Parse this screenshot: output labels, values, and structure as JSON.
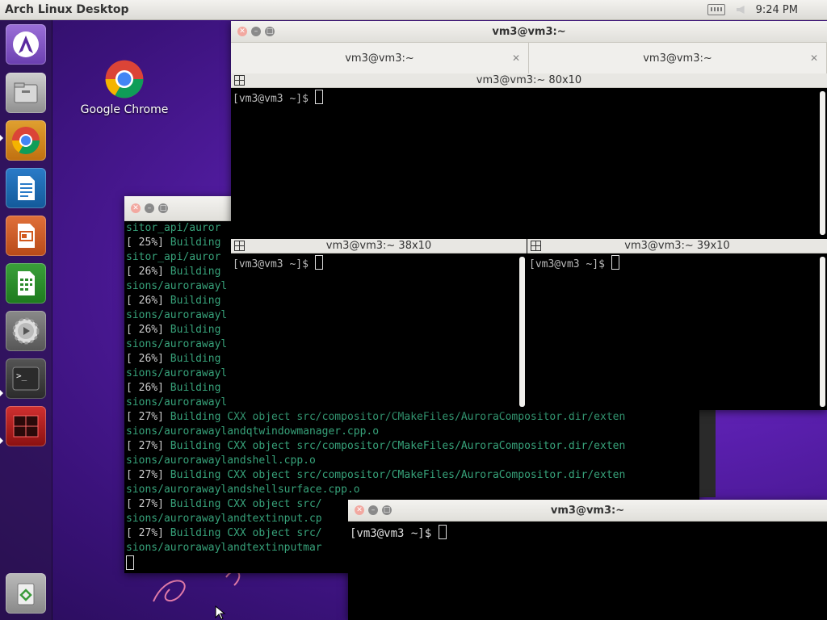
{
  "topbar": {
    "title": "Arch Linux Desktop",
    "time": "9:24 PM"
  },
  "launcher": {
    "items": [
      {
        "name": "arch-logo-icon"
      },
      {
        "name": "files-icon"
      },
      {
        "name": "chrome-icon"
      },
      {
        "name": "libreoffice-writer-icon"
      },
      {
        "name": "libreoffice-impress-icon"
      },
      {
        "name": "libreoffice-calc-icon"
      },
      {
        "name": "settings-icon"
      },
      {
        "name": "terminal-icon"
      },
      {
        "name": "terminator-icon"
      },
      {
        "name": "trash-icon"
      }
    ]
  },
  "desktop_icons": [
    {
      "label": "Google Chrome"
    }
  ],
  "main_window": {
    "title": "vm3@vm3:~",
    "tabs": [
      {
        "label": "vm3@vm3:~"
      },
      {
        "label": "vm3@vm3:~"
      }
    ],
    "panes": [
      {
        "header": "vm3@vm3:~ 80x10",
        "prompt": "[vm3@vm3 ~]$ "
      },
      {
        "header": "vm3@vm3:~ 38x10",
        "prompt": "[vm3@vm3 ~]$ "
      },
      {
        "header": "vm3@vm3:~ 39x10",
        "prompt": "[vm3@vm3 ~]$ "
      }
    ]
  },
  "build_window": {
    "lines": [
      {
        "pct": "",
        "text": "sitor_api/auror"
      },
      {
        "pct": "[ 25%] ",
        "text": "Building"
      },
      {
        "pct": "",
        "text": "sitor_api/auror"
      },
      {
        "pct": "[ 26%] ",
        "text": "Building"
      },
      {
        "pct": "",
        "text": "sions/aurorawayl"
      },
      {
        "pct": "[ 26%] ",
        "text": "Building"
      },
      {
        "pct": "",
        "text": "sions/aurorawayl"
      },
      {
        "pct": "[ 26%] ",
        "text": "Building"
      },
      {
        "pct": "",
        "text": "sions/aurorawayl"
      },
      {
        "pct": "[ 26%] ",
        "text": "Building"
      },
      {
        "pct": "",
        "text": "sions/aurorawayl"
      },
      {
        "pct": "[ 26%] ",
        "text": "Building"
      },
      {
        "pct": "",
        "text": "sions/aurorawayl"
      },
      {
        "pct": "[ 27%] ",
        "text": "Building CXX object src/compositor/CMakeFiles/AuroraCompositor.dir/exten"
      },
      {
        "pct": "",
        "text": "sions/aurorawaylandqtwindowmanager.cpp.o"
      },
      {
        "pct": "[ 27%] ",
        "text": "Building CXX object src/compositor/CMakeFiles/AuroraCompositor.dir/exten"
      },
      {
        "pct": "",
        "text": "sions/aurorawaylandshell.cpp.o"
      },
      {
        "pct": "[ 27%] ",
        "text": "Building CXX object src/compositor/CMakeFiles/AuroraCompositor.dir/exten"
      },
      {
        "pct": "",
        "text": "sions/aurorawaylandshellsurface.cpp.o"
      },
      {
        "pct": "[ 27%] ",
        "text": "Building CXX object src/"
      },
      {
        "pct": "",
        "text": "sions/aurorawaylandtextinput.cp"
      },
      {
        "pct": "[ 27%] ",
        "text": "Building CXX object src/"
      },
      {
        "pct": "",
        "text": "sions/aurorawaylandtextinputmar"
      }
    ]
  },
  "small_window": {
    "title": "vm3@vm3:~",
    "prompt": "[vm3@vm3 ~]$ "
  }
}
